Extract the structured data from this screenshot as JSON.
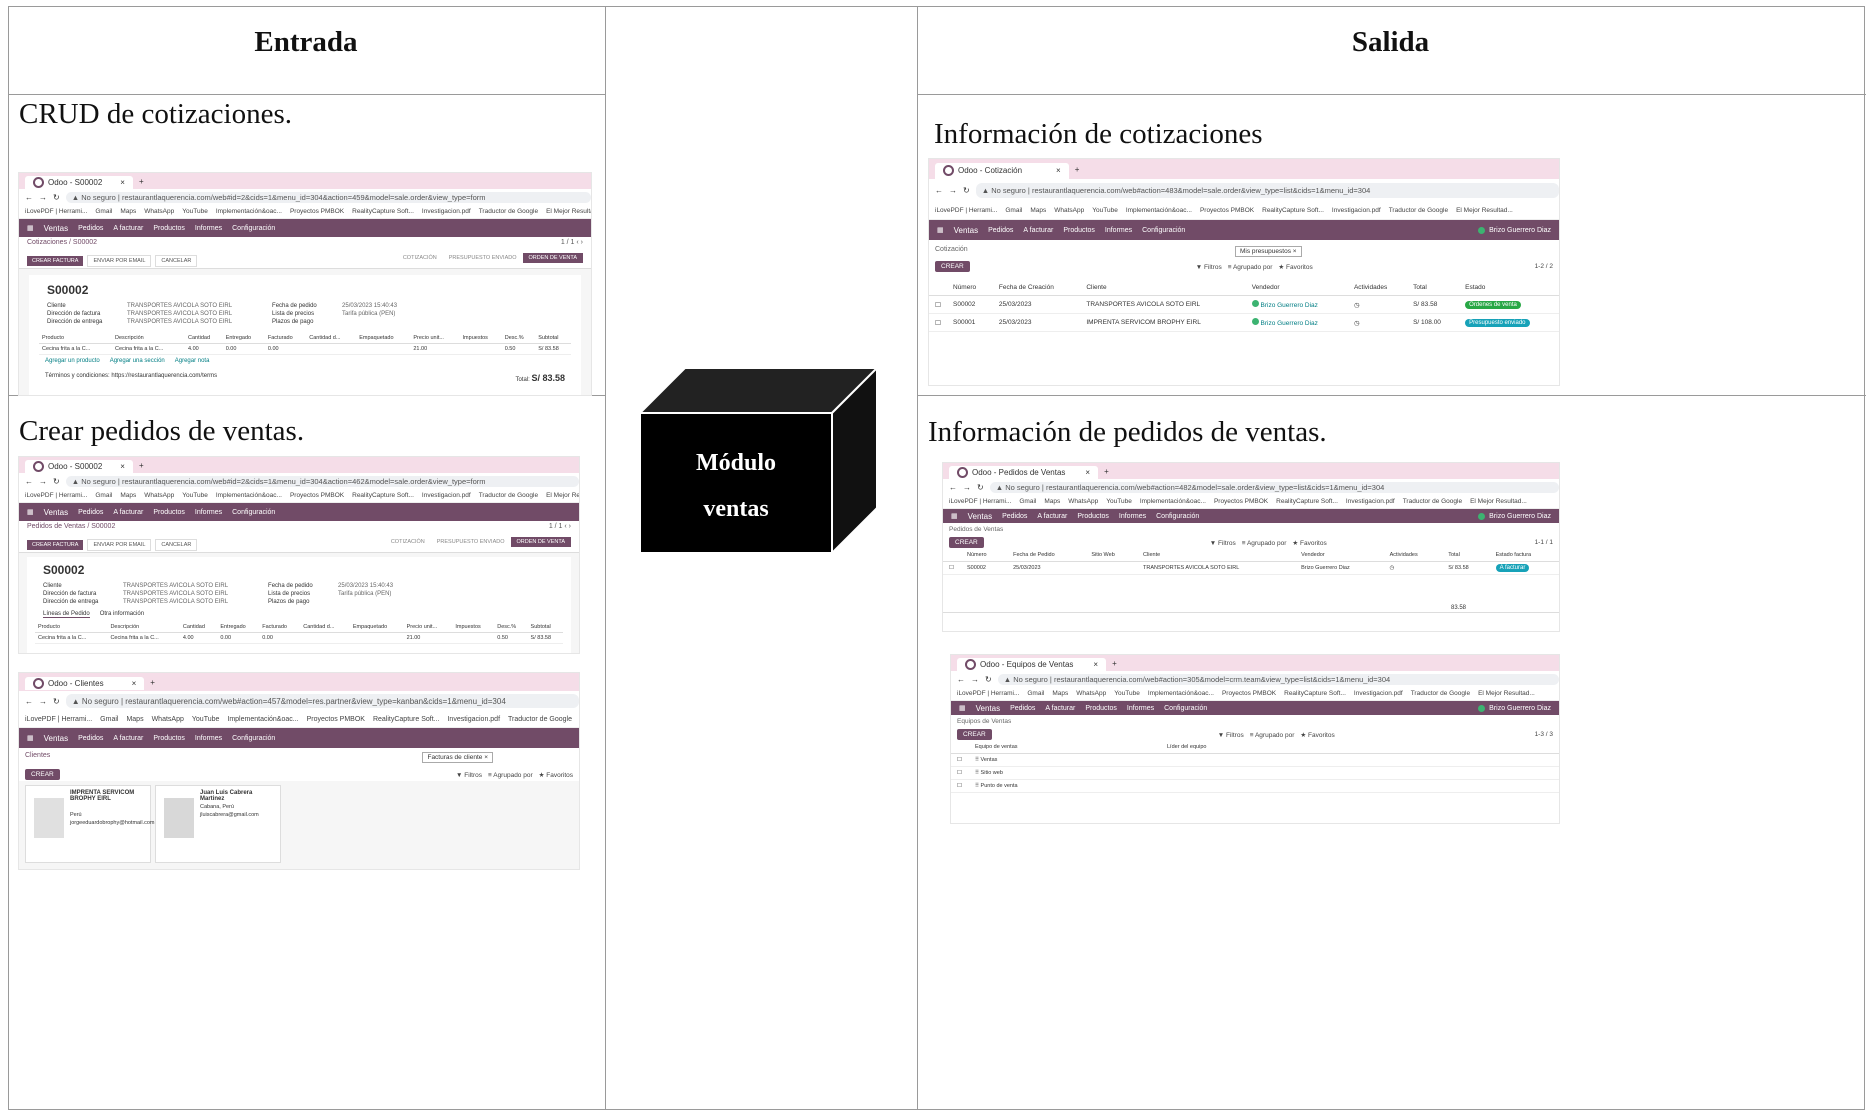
{
  "headers": {
    "entrada": "Entrada",
    "salida": "Salida"
  },
  "module": {
    "line1": "Módulo",
    "line2": "ventas"
  },
  "captions": {
    "crud": "CRUD de cotizaciones.",
    "crear": "Crear pedidos de ventas.",
    "info_cot": "Información de cotizaciones",
    "info_ped": "Información de pedidos de ventas."
  },
  "browser": {
    "bookmarks": [
      "iLovePDF | Herrami...",
      "Gmail",
      "Maps",
      "WhatsApp",
      "YouTube",
      "Implementación&oac...",
      "Proyectos PMBOK",
      "RealityCapture Soft...",
      "Investigacion.pdf",
      "Traductor de Google",
      "El Mejor Resultad..."
    ],
    "security": "No seguro"
  },
  "shot_crud": {
    "tab": "Odoo - S00002",
    "url": "restaurantlaquerencia.com/web#id=2&cids=1&menu_id=304&action=459&model=sale.order&view_type=form",
    "nav": [
      "Ventas",
      "Pedidos",
      "A facturar",
      "Productos",
      "Informes",
      "Configuración"
    ],
    "breadcrumb": "Cotizaciones / S00002",
    "buttons": [
      "CREAR FACTURA",
      "ENVIAR POR EMAIL",
      "CANCELAR"
    ],
    "stages": [
      "COTIZACIÓN",
      "PRESUPUESTO ENVIADO",
      "ORDEN DE VENTA"
    ],
    "order": "S00002",
    "fields": [
      {
        "label": "Cliente",
        "value": "TRANSPORTES AVICOLA SOTO EIRL"
      },
      {
        "label": "Dirección de factura",
        "value": "TRANSPORTES AVICOLA SOTO EIRL"
      },
      {
        "label": "Dirección de entrega",
        "value": "TRANSPORTES AVICOLA SOTO EIRL"
      }
    ],
    "right_fields": [
      {
        "label": "Fecha de pedido",
        "value": "25/03/2023 15:40:43"
      },
      {
        "label": "Lista de precios",
        "value": "Tarifa pública (PEN)"
      },
      {
        "label": "Plazos de pago",
        "value": ""
      }
    ],
    "cols": [
      "Producto",
      "Descripción",
      "Cantidad",
      "Entregado",
      "Facturado",
      "Cantidad d...",
      "Empaquetado",
      "Precio unit...",
      "Impuestos",
      "Desc.%",
      "Subtotal"
    ],
    "row": [
      "Cecina frita a la C...",
      "Cecina frita a la C...",
      "4.00",
      "0.00",
      "0.00",
      "",
      "",
      "21.00",
      "",
      "0.50",
      "S/ 83.58"
    ],
    "actions": [
      "Agregar un producto",
      "Agregar una sección",
      "Agregar nota"
    ],
    "terms": "Términos y condiciones: https://restaurantlaquerencia.com/terms",
    "total_label": "Total:",
    "total": "S/ 83.58"
  },
  "shot_crear": {
    "tab": "Odoo - S00002",
    "url": "restaurantlaquerencia.com/web#id=2&cids=1&menu_id=304&action=462&model=sale.order&view_type=form",
    "nav": [
      "Ventas",
      "Pedidos",
      "A facturar",
      "Productos",
      "Informes",
      "Configuración"
    ],
    "breadcrumb": "Pedidos de Ventas / S00002",
    "buttons": [
      "CREAR FACTURA",
      "ENVIAR POR EMAIL",
      "CANCELAR"
    ],
    "stages": [
      "COTIZACIÓN",
      "PRESUPUESTO ENVIADO",
      "ORDEN DE VENTA"
    ],
    "order": "S00002",
    "fields": [
      {
        "label": "Cliente",
        "value": "TRANSPORTES AVICOLA SOTO EIRL"
      },
      {
        "label": "Dirección de factura",
        "value": "TRANSPORTES AVICOLA SOTO EIRL"
      },
      {
        "label": "Dirección de entrega",
        "value": "TRANSPORTES AVICOLA SOTO EIRL"
      }
    ],
    "right_fields": [
      {
        "label": "Fecha de pedido",
        "value": "25/03/2023 15:40:43"
      },
      {
        "label": "Lista de precios",
        "value": "Tarifa pública (PEN)"
      },
      {
        "label": "Plazos de pago",
        "value": ""
      }
    ],
    "tabs": [
      "Líneas de Pedido",
      "Otra información"
    ],
    "cols": [
      "Producto",
      "Descripción",
      "Cantidad",
      "Entregado",
      "Facturado",
      "Cantidad d...",
      "Empaquetado",
      "Precio unit...",
      "Impuestos",
      "Desc.%",
      "Subtotal"
    ],
    "row": [
      "Cecina frita a la C...",
      "Cecina frita a la C...",
      "4.00",
      "0.00",
      "0.00",
      "",
      "",
      "21.00",
      "",
      "0.50",
      "S/ 83.58"
    ]
  },
  "shot_clientes": {
    "tab": "Odoo - Clientes",
    "url": "restaurantlaquerencia.com/web#action=457&model=res.partner&view_type=kanban&cids=1&menu_id=304",
    "nav": [
      "Ventas",
      "Pedidos",
      "A facturar",
      "Productos",
      "Informes",
      "Configuración"
    ],
    "title": "Clientes",
    "filter": "Facturas de cliente",
    "create": "CREAR",
    "tools": [
      "Filtros",
      "Agrupado por",
      "Favoritos"
    ],
    "cards": [
      {
        "name": "IMPRENTA SERVICOM BROPHY EIRL",
        "line1": "Perú",
        "line2": "jorgeeduardobrophy@hotmail.com"
      },
      {
        "name": "Juan Luis Cabrera Martinez",
        "line1": "Cabana, Perú",
        "line2": "jluiscabrera@gmail.com"
      }
    ]
  },
  "shot_cot": {
    "tab": "Odoo - Cotización",
    "url": "restaurantlaquerencia.com/web#action=483&model=sale.order&view_type=list&cids=1&menu_id=304",
    "nav": [
      "Ventas",
      "Pedidos",
      "A facturar",
      "Productos",
      "Informes",
      "Configuración"
    ],
    "user": "Brizo Guerrero Diaz",
    "title": "Cotización",
    "filter": "Mis presupuestos",
    "create": "CREAR",
    "tools": [
      "Filtros",
      "Agrupado por",
      "Favoritos"
    ],
    "pager": "1-2 / 2",
    "cols": [
      "Número",
      "Fecha de Creación",
      "Cliente",
      "Vendedor",
      "Actividades",
      "Total",
      "Estado"
    ],
    "rows": [
      {
        "num": "S00002",
        "date": "25/03/2023",
        "client": "TRANSPORTES AVICOLA SOTO EIRL",
        "seller": "Brizo Guerrero Diaz",
        "total": "S/ 83.58",
        "state": "Órdenes de venta"
      },
      {
        "num": "S00001",
        "date": "25/03/2023",
        "client": "IMPRENTA SERVICOM BROPHY EIRL",
        "seller": "Brizo Guerrero Diaz",
        "total": "S/ 108.00",
        "state": "Presupuesto enviado"
      }
    ]
  },
  "shot_ped": {
    "tab": "Odoo - Pedidos de Ventas",
    "url": "restaurantlaquerencia.com/web#action=482&model=sale.order&view_type=list&cids=1&menu_id=304",
    "nav": [
      "Ventas",
      "Pedidos",
      "A facturar",
      "Productos",
      "Informes",
      "Configuración"
    ],
    "user": "Brizo Guerrero Diaz",
    "title": "Pedidos de Ventas",
    "create": "CREAR",
    "tools": [
      "Filtros",
      "Agrupado por",
      "Favoritos"
    ],
    "pager": "1-1 / 1",
    "cols": [
      "Número",
      "Fecha de Pedido",
      "Sitio Web",
      "Cliente",
      "Vendedor",
      "Actividades",
      "Total",
      "Estado factura"
    ],
    "row": {
      "num": "S00002",
      "date": "25/03/2023",
      "client": "TRANSPORTES AVICOLA SOTO EIRL",
      "seller": "Brizo Guerrero Diaz",
      "total": "S/ 83.58",
      "state": "A facturar"
    },
    "sum": "83.58"
  },
  "shot_eq": {
    "tab": "Odoo - Equipos de Ventas",
    "url": "restaurantlaquerencia.com/web#action=305&model=crm.team&view_type=list&cids=1&menu_id=304",
    "nav": [
      "Ventas",
      "Pedidos",
      "A facturar",
      "Productos",
      "Informes",
      "Configuración"
    ],
    "user": "Brizo Guerrero Diaz",
    "title": "Equipos de Ventas",
    "create": "CREAR",
    "tools": [
      "Filtros",
      "Agrupado por",
      "Favoritos"
    ],
    "pager": "1-3 / 3",
    "cols": [
      "Equipo de ventas",
      "Líder del equipo"
    ],
    "rows": [
      "Ventas",
      "Sitio web",
      "Punto de venta"
    ]
  }
}
